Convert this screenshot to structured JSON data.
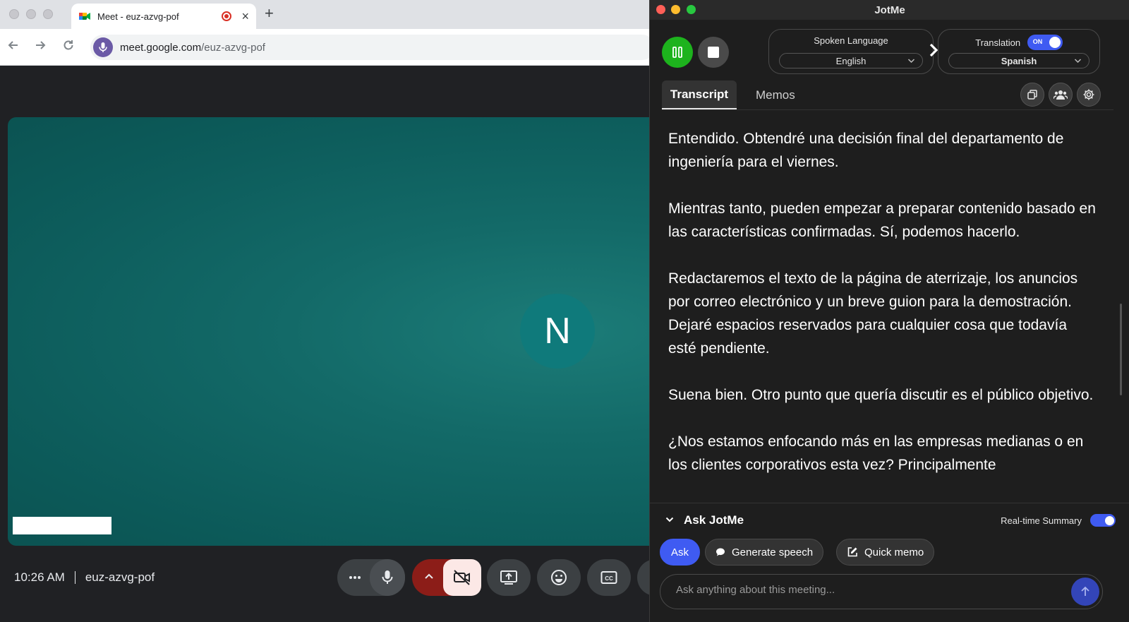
{
  "browser": {
    "tab_title": "Meet - euz-azvg-pof",
    "url_domain": "meet.google.com",
    "url_path": "/euz-azvg-pof",
    "new_tab_label": "+",
    "close_label": "×"
  },
  "meet": {
    "participant_initial": "N",
    "time": "10:26 AM",
    "meeting_code": "euz-azvg-pof",
    "colors": {
      "stage": "#0d5d5c",
      "cam_off_bg": "#fce8e6",
      "cam_off_group": "#8c1d18"
    }
  },
  "jotme": {
    "app_title": "JotMe",
    "spoken_language": {
      "label": "Spoken Language",
      "value": "English"
    },
    "translation": {
      "label": "Translation",
      "toggle_text": "ON",
      "value": "Spanish"
    },
    "tabs": {
      "transcript": "Transcript",
      "memos": "Memos"
    },
    "transcript": [
      "Entendido. Obtendré una decisión final del departamento de ingeniería para el viernes.",
      "Mientras tanto, pueden empezar a preparar contenido basado en las características confirmadas. Sí, podemos hacerlo.",
      "Redactaremos el texto de la página de aterrizaje, los anuncios por correo electrónico y un breve guion para la demostración. Dejaré espacios reservados para cualquier cosa que todavía esté pendiente.",
      "Suena bien. Otro punto que quería discutir es el público objetivo.",
      "¿Nos estamos enfocando más en las empresas medianas o en los clientes corporativos esta vez? Principalmente"
    ],
    "ask": {
      "title": "Ask JotMe",
      "realtime_summary": "Real-time Summary",
      "ask_button": "Ask",
      "generate_speech": "Generate speech",
      "quick_memo": "Quick memo",
      "placeholder": "Ask anything about this meeting..."
    },
    "colors": {
      "accent": "#3f5bf2",
      "play": "#1db31d"
    }
  }
}
